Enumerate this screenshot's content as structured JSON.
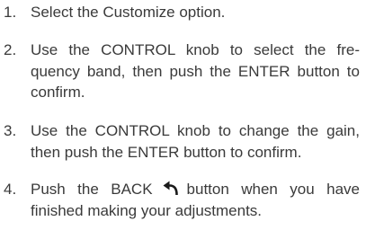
{
  "steps": [
    {
      "number": "1.",
      "text": "Select the Customize option."
    },
    {
      "number": "2.",
      "text": "Use the CONTROL knob to select the fre-quency band, then push the ENTER button to confirm."
    },
    {
      "number": "3.",
      "text": "Use the CONTROL knob to change the gain, then push the ENTER button to confirm."
    },
    {
      "number": "4.",
      "text_before_icon": "Push the BACK",
      "icon": "back-arrow-icon",
      "text_after_icon": "button when you have finished making your adjustments."
    }
  ],
  "colors": {
    "text": "#3a3a3a",
    "background": "#ffffff"
  }
}
